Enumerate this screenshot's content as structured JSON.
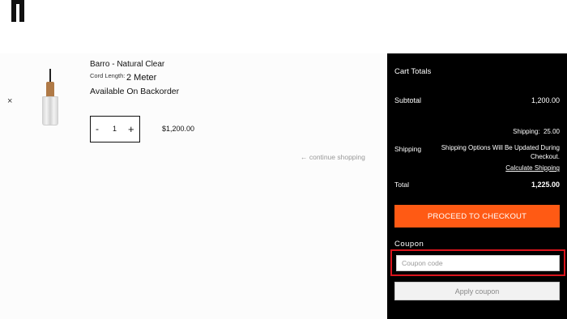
{
  "cart": {
    "remove_label": "×",
    "product": {
      "name": "Barro - Natural Clear",
      "cord_label": "Cord Length:",
      "cord_value": "2 Meter",
      "availability": "Available On Backorder",
      "quantity": "1",
      "minus": "-",
      "plus": "+",
      "price": "$1,200.00"
    },
    "continue_shopping": "← continue shopping"
  },
  "totals": {
    "title": "Cart Totals",
    "subtotal_label": "Subtotal",
    "subtotal_value": "1,200.00",
    "shipping_cost": "Shipping:  25.00",
    "shipping_label": "Shipping",
    "shipping_note": "Shipping Options Will Be Updated During Checkout.",
    "calculate_shipping": "Calculate Shipping",
    "total_label": "Total",
    "total_value": "1,225.00",
    "checkout_button": "PROCEED TO CHECKOUT"
  },
  "coupon": {
    "title": "Coupon",
    "placeholder": "Coupon code",
    "apply_button": "Apply coupon"
  },
  "colors": {
    "accent": "#ff5a14",
    "highlight": "#d9141c",
    "panel": "#000000"
  },
  "icons": {
    "logo": "pants-logo-icon",
    "remove": "close-icon",
    "product_image": "pendant-lamp-thumbnail"
  }
}
